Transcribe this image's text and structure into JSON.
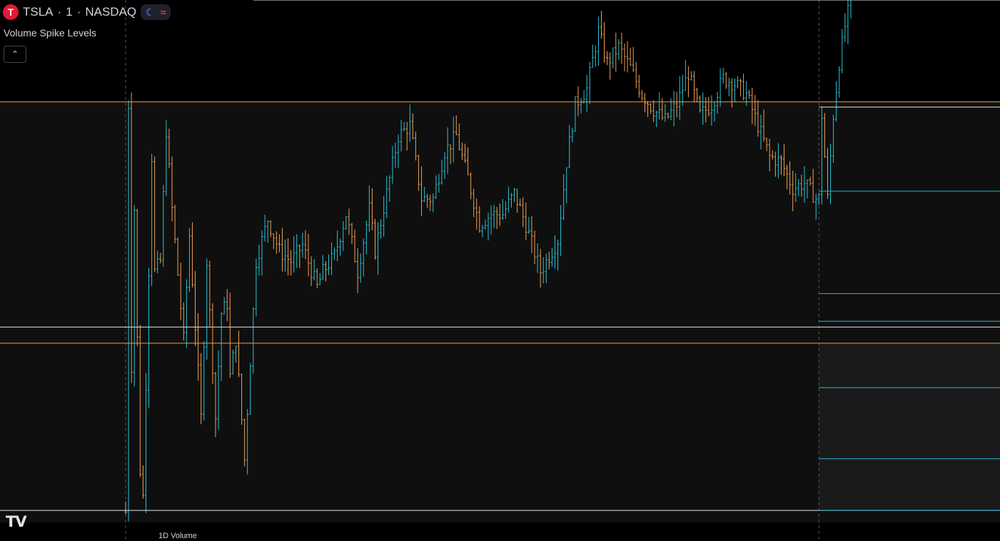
{
  "header": {
    "symbol": "TSLA",
    "sep1": "·",
    "interval": "1",
    "sep2": "·",
    "exchange": "NASDAQ",
    "logo_glyph": "T",
    "moon_glyph": "☾",
    "wave_glyph": "≈"
  },
  "indicator": {
    "name": "Volume Spike Levels",
    "collapse_glyph": "⌃"
  },
  "watermark": {
    "logo_text": "TV"
  },
  "volume_label": "1D Volume",
  "colors": {
    "background": "#000000",
    "zone": "#0f0f0f",
    "zone_light": "#1a1a1a",
    "up_bar": "#26c6da",
    "down_bar": "#f0a050",
    "orange_level": "#f39c3c",
    "white_level": "#e6e6e6",
    "cyan_level": "#29b6d6",
    "session_divider": "#555555"
  },
  "chart_data": {
    "type": "ohlc",
    "x_range": [
      0,
      250
    ],
    "price_range": [
      0,
      100
    ],
    "session_break_bar": 239,
    "anchors": [
      [
        0,
        2
      ],
      [
        1,
        80
      ],
      [
        2,
        30
      ],
      [
        3,
        60
      ],
      [
        5,
        10
      ],
      [
        6,
        5
      ],
      [
        9,
        70
      ],
      [
        10,
        48
      ],
      [
        12,
        50
      ],
      [
        14,
        75
      ],
      [
        16,
        60
      ],
      [
        20,
        35
      ],
      [
        22,
        55
      ],
      [
        26,
        20
      ],
      [
        28,
        50
      ],
      [
        31,
        20
      ],
      [
        33,
        40
      ],
      [
        35,
        42
      ],
      [
        36,
        28
      ],
      [
        38,
        35
      ],
      [
        41,
        12
      ],
      [
        45,
        50
      ],
      [
        49,
        58
      ],
      [
        53,
        52
      ],
      [
        57,
        50
      ],
      [
        61,
        53
      ],
      [
        66,
        45
      ],
      [
        68,
        48
      ],
      [
        72,
        51
      ],
      [
        76,
        59
      ],
      [
        80,
        48
      ],
      [
        84,
        60
      ],
      [
        86,
        52
      ],
      [
        90,
        63
      ],
      [
        94,
        74
      ],
      [
        98,
        76
      ],
      [
        102,
        62
      ],
      [
        106,
        62
      ],
      [
        110,
        71
      ],
      [
        114,
        74
      ],
      [
        118,
        66
      ],
      [
        122,
        57
      ],
      [
        126,
        59
      ],
      [
        130,
        59
      ],
      [
        134,
        63
      ],
      [
        138,
        57
      ],
      [
        143,
        48
      ],
      [
        149,
        54
      ],
      [
        152,
        69
      ],
      [
        155,
        80
      ],
      [
        159,
        83
      ],
      [
        163,
        94
      ],
      [
        166,
        88
      ],
      [
        170,
        91
      ],
      [
        174,
        87
      ],
      [
        178,
        82
      ],
      [
        182,
        79
      ],
      [
        186,
        77
      ],
      [
        190,
        80
      ],
      [
        194,
        86
      ],
      [
        198,
        78
      ],
      [
        202,
        80
      ],
      [
        206,
        85
      ],
      [
        210,
        84
      ],
      [
        214,
        82
      ],
      [
        218,
        76
      ],
      [
        222,
        70
      ],
      [
        226,
        69
      ],
      [
        230,
        64
      ],
      [
        234,
        65
      ],
      [
        238,
        62
      ],
      [
        239,
        62
      ],
      [
        240,
        78
      ],
      [
        242,
        62
      ],
      [
        244,
        78
      ],
      [
        246,
        88
      ],
      [
        248,
        95
      ],
      [
        250,
        100
      ]
    ],
    "levels": [
      {
        "kind": "orange",
        "price": 80.5,
        "x_start": 0
      },
      {
        "kind": "orange",
        "price": 34.3,
        "x_start": 0
      },
      {
        "kind": "white",
        "price": 100,
        "x_start": 44
      },
      {
        "kind": "white",
        "price": 37.4,
        "x_start": 0
      },
      {
        "kind": "white",
        "price": 2.3,
        "x_start": 0
      },
      {
        "kind": "white",
        "price": 79.5,
        "x_start": 239
      },
      {
        "kind": "cyan",
        "price": 63.4,
        "x_start": 239
      },
      {
        "kind": "cyan",
        "price": 43.8,
        "x_start": 239
      },
      {
        "kind": "cyan",
        "price": 38.5,
        "x_start": 239
      },
      {
        "kind": "cyan",
        "price": 25.8,
        "x_start": 239
      },
      {
        "kind": "cyan",
        "price": 12.2,
        "x_start": 239
      },
      {
        "kind": "cyan",
        "price": 2.3,
        "x_start": 239
      }
    ],
    "zones": [
      {
        "from": 0,
        "to": 80.5,
        "x_start": 0,
        "shade": "zone"
      },
      {
        "from": 2.3,
        "to": 34.3,
        "x_start": 239,
        "shade": "zone_light"
      }
    ]
  }
}
